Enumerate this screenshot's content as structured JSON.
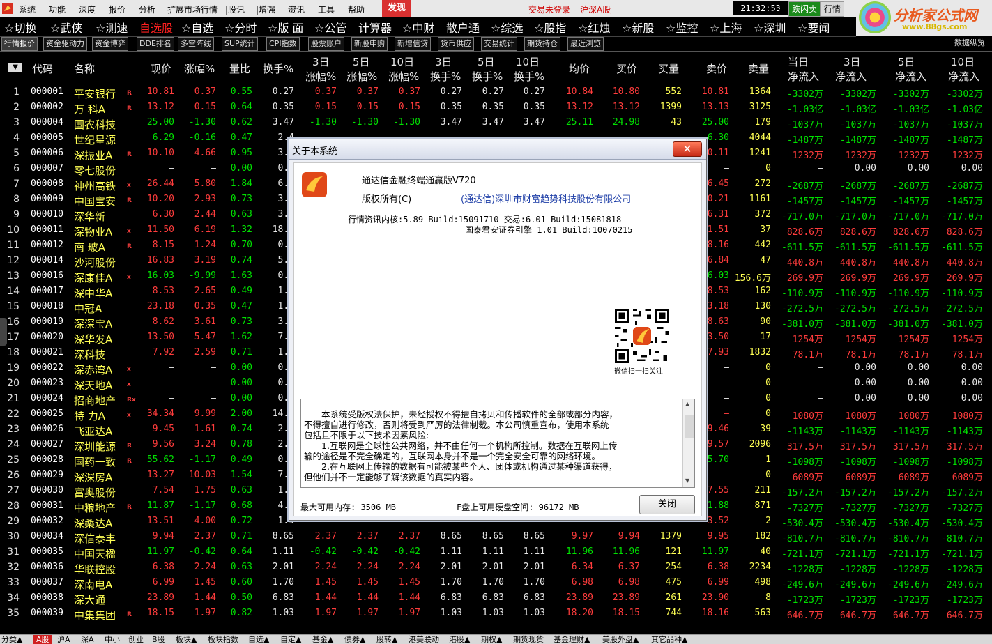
{
  "menu": {
    "items": [
      "系统",
      "功能",
      "深度",
      "报价",
      "分析",
      "扩展市场行情",
      "|股讯",
      "|增强",
      "资讯",
      "工具",
      "帮助"
    ],
    "find": "发现",
    "warn1": "交易未登录",
    "warn2": "沪深A股",
    "clock": "21:32:53",
    "weekday": "周日",
    "right_tabs": [
      "跌闪卖",
      "行情"
    ]
  },
  "brand": {
    "name": "分析家公式网",
    "url": "www.88gs.com"
  },
  "toolbar": [
    "☆切换",
    "☆武侠",
    "☆测速",
    "自选股",
    "☆自选",
    "☆分时",
    "☆版 面",
    "☆公管",
    "计算器",
    "☆中财",
    "散户通",
    "☆综选",
    "☆股指",
    "☆红烛",
    "☆新股",
    "☆监控",
    "☆上海",
    "☆深圳",
    "☆要闻"
  ],
  "subtabs": [
    "行情报价",
    "资金驱动力",
    "资金博弈",
    "DDE排名",
    "多空阵线",
    "SUP统计",
    "CPI指数",
    "股票账户",
    "新股申购",
    "新增信贷",
    "货币供应",
    "交易统计",
    "期货持仓",
    "最近浏览"
  ],
  "subtab_right": "数据纵览",
  "headers": {
    "code": "代码",
    "name": "名称",
    "price": "现价",
    "chg": "涨幅%",
    "vr": "量比",
    "turn": "换手%",
    "d3": "3日",
    "d5": "5日",
    "d10": "10日",
    "chgpct": "涨幅%",
    "turnpct": "换手%",
    "avg": "均价",
    "bid": "买价",
    "bidvol": "买量",
    "ask": "卖价",
    "askvol": "卖量",
    "today": "当日",
    "netflow": "净流入"
  },
  "rows": [
    [
      "1",
      "000001",
      "平安银行",
      "R",
      "10.81",
      "0.37",
      "0.55",
      "0.27",
      "0.37",
      "0.37",
      "0.37",
      "0.27",
      "0.27",
      "0.27",
      "10.84",
      "10.80",
      "552",
      "10.81",
      "1364",
      "-3302万",
      "-3302万",
      "-3302万",
      "-3302万"
    ],
    [
      "2",
      "000002",
      "万 科A",
      "R",
      "13.12",
      "0.15",
      "0.64",
      "0.35",
      "0.15",
      "0.15",
      "0.15",
      "0.35",
      "0.35",
      "0.35",
      "13.12",
      "13.12",
      "1399",
      "13.13",
      "3125",
      "-1.03亿",
      "-1.03亿",
      "-1.03亿",
      "-1.03亿"
    ],
    [
      "3",
      "000004",
      "国农科技",
      "",
      "25.00",
      "-1.30",
      "0.62",
      "3.47",
      "-1.30",
      "-1.30",
      "-1.30",
      "3.47",
      "3.47",
      "3.47",
      "25.11",
      "24.98",
      "43",
      "25.00",
      "179",
      "-1037万",
      "-1037万",
      "-1037万",
      "-1037万"
    ],
    [
      "4",
      "000005",
      "世纪星源",
      "",
      "6.29",
      "-0.16",
      "0.47",
      "2.4",
      "",
      "",
      "",
      "",
      "",
      "",
      "",
      "",
      "",
      "6.30",
      "4044",
      "-1487万",
      "-1487万",
      "-1487万",
      "-1487万"
    ],
    [
      "5",
      "000006",
      "深振业A",
      "R",
      "10.10",
      "4.66",
      "0.95",
      "3.6",
      "",
      "",
      "",
      "",
      "",
      "",
      "",
      "",
      "",
      "0.11",
      "1241",
      "1232万",
      "1232万",
      "1232万",
      "1232万"
    ],
    [
      "6",
      "000007",
      "零七股份",
      "",
      "—",
      "—",
      "0.00",
      "0.0",
      "",
      "",
      "",
      "",
      "",
      "",
      "",
      "",
      "",
      "—",
      "0",
      "—",
      "0.00",
      "0.00",
      "0.00"
    ],
    [
      "7",
      "000008",
      "神州高铁",
      "x",
      "26.44",
      "5.80",
      "1.84",
      "6.8",
      "",
      "",
      "",
      "",
      "",
      "",
      "",
      "",
      "",
      "6.45",
      "272",
      "-2687万",
      "-2687万",
      "-2687万",
      "-2687万"
    ],
    [
      "8",
      "000009",
      "中国宝安",
      "R",
      "10.20",
      "2.93",
      "0.73",
      "3.4",
      "",
      "",
      "",
      "",
      "",
      "",
      "",
      "",
      "",
      "0.21",
      "1161",
      "-1457万",
      "-1457万",
      "-1457万",
      "-1457万"
    ],
    [
      "9",
      "000010",
      "深华新",
      "",
      "6.30",
      "2.44",
      "0.63",
      "3.2",
      "",
      "",
      "",
      "",
      "",
      "",
      "",
      "",
      "",
      "6.31",
      "372",
      "-717.0万",
      "-717.0万",
      "-717.0万",
      "-717.0万"
    ],
    [
      "10",
      "000011",
      "深物业A",
      "x",
      "11.50",
      "6.19",
      "1.32",
      "18.0",
      "",
      "",
      "",
      "",
      "",
      "",
      "",
      "",
      "",
      "1.51",
      "37",
      "828.6万",
      "828.6万",
      "828.6万",
      "828.6万"
    ],
    [
      "11",
      "000012",
      "南 玻A",
      "R",
      "8.15",
      "1.24",
      "0.70",
      "0.9",
      "",
      "",
      "",
      "",
      "",
      "",
      "",
      "",
      "",
      "8.16",
      "442",
      "-611.5万",
      "-611.5万",
      "-611.5万",
      "-611.5万"
    ],
    [
      "12",
      "000014",
      "沙河股份",
      "",
      "16.83",
      "3.19",
      "0.74",
      "5.0",
      "",
      "",
      "",
      "",
      "",
      "",
      "",
      "",
      "",
      "6.84",
      "47",
      "440.8万",
      "440.8万",
      "440.8万",
      "440.8万"
    ],
    [
      "13",
      "000016",
      "深康佳A",
      "x",
      "16.03",
      "-9.99",
      "1.63",
      "0.0",
      "",
      "",
      "",
      "",
      "",
      "",
      "",
      "",
      "",
      "6.03",
      "156.6万",
      "269.9万",
      "269.9万",
      "269.9万",
      "269.9万"
    ],
    [
      "14",
      "000017",
      "深中华A",
      "",
      "8.53",
      "2.65",
      "0.49",
      "1.8",
      "",
      "",
      "",
      "",
      "",
      "",
      "",
      "",
      "",
      "8.53",
      "162",
      "-110.9万",
      "-110.9万",
      "-110.9万",
      "-110.9万"
    ],
    [
      "15",
      "000018",
      "中冠A",
      "",
      "23.18",
      "0.35",
      "0.47",
      "1.5",
      "",
      "",
      "",
      "",
      "",
      "",
      "",
      "",
      "",
      "3.18",
      "130",
      "-272.5万",
      "-272.5万",
      "-272.5万",
      "-272.5万"
    ],
    [
      "16",
      "000019",
      "深深宝A",
      "",
      "8.62",
      "3.61",
      "0.73",
      "3.5",
      "",
      "",
      "",
      "",
      "",
      "",
      "",
      "",
      "",
      "8.63",
      "90",
      "-381.0万",
      "-381.0万",
      "-381.0万",
      "-381.0万"
    ],
    [
      "17",
      "000020",
      "深华发A",
      "",
      "13.50",
      "5.47",
      "1.62",
      "7.6",
      "",
      "",
      "",
      "",
      "",
      "",
      "",
      "",
      "",
      "3.50",
      "17",
      "1254万",
      "1254万",
      "1254万",
      "1254万"
    ],
    [
      "18",
      "000021",
      "深科技",
      "",
      "7.92",
      "2.59",
      "0.71",
      "1.4",
      "",
      "",
      "",
      "",
      "",
      "",
      "",
      "",
      "",
      "7.93",
      "1832",
      "78.1万",
      "78.1万",
      "78.1万",
      "78.1万"
    ],
    [
      "19",
      "000022",
      "深赤湾A",
      "x",
      "—",
      "—",
      "0.00",
      "0.0",
      "",
      "",
      "",
      "",
      "",
      "",
      "",
      "",
      "",
      "—",
      "0",
      "—",
      "0.00",
      "0.00",
      "0.00"
    ],
    [
      "20",
      "000023",
      "深天地A",
      "x",
      "—",
      "—",
      "0.00",
      "0.0",
      "",
      "",
      "",
      "",
      "",
      "",
      "",
      "",
      "",
      "—",
      "0",
      "—",
      "0.00",
      "0.00",
      "0.00"
    ],
    [
      "21",
      "000024",
      "招商地产",
      "Rx",
      "—",
      "—",
      "0.00",
      "0.0",
      "",
      "",
      "",
      "",
      "",
      "",
      "",
      "",
      "",
      "—",
      "0",
      "—",
      "0.00",
      "0.00",
      "0.00"
    ],
    [
      "22",
      "000025",
      "特 力A",
      "x",
      "34.34",
      "9.99",
      "2.00",
      "14.2",
      "",
      "",
      "",
      "",
      "",
      "",
      "",
      "",
      "",
      "—",
      "0",
      "1080万",
      "1080万",
      "1080万",
      "1080万"
    ],
    [
      "23",
      "000026",
      "飞亚达A",
      "",
      "9.45",
      "1.61",
      "0.74",
      "2.4",
      "",
      "",
      "",
      "",
      "",
      "",
      "",
      "",
      "",
      "9.46",
      "39",
      "-1143万",
      "-1143万",
      "-1143万",
      "-1143万"
    ],
    [
      "24",
      "000027",
      "深圳能源",
      "R",
      "9.56",
      "3.24",
      "0.78",
      "2.7",
      "",
      "",
      "",
      "",
      "",
      "",
      "",
      "",
      "",
      "9.57",
      "2096",
      "317.5万",
      "317.5万",
      "317.5万",
      "317.5万"
    ],
    [
      "25",
      "000028",
      "国药一致",
      "R",
      "55.62",
      "-1.17",
      "0.49",
      "0.6",
      "",
      "",
      "",
      "",
      "",
      "",
      "",
      "",
      "",
      "5.70",
      "1",
      "-1098万",
      "-1098万",
      "-1098万",
      "-1098万"
    ],
    [
      "26",
      "000029",
      "深深房A",
      "",
      "13.27",
      "10.03",
      "1.54",
      "7.9",
      "",
      "",
      "",
      "",
      "",
      "",
      "",
      "",
      "",
      "—",
      "0",
      "6089万",
      "6089万",
      "6089万",
      "6089万"
    ],
    [
      "27",
      "000030",
      "富奥股份",
      "",
      "7.54",
      "1.75",
      "0.63",
      "1.3",
      "",
      "",
      "",
      "",
      "",
      "",
      "",
      "",
      "",
      "7.55",
      "211",
      "-157.2万",
      "-157.2万",
      "-157.2万",
      "-157.2万"
    ],
    [
      "28",
      "000031",
      "中粮地产",
      "R",
      "11.87",
      "-1.17",
      "0.68",
      "4.5",
      "",
      "",
      "",
      "",
      "",
      "",
      "",
      "",
      "",
      "1.88",
      "871",
      "-7327万",
      "-7327万",
      "-7327万",
      "-7327万"
    ],
    [
      "29",
      "000032",
      "深桑达A",
      "",
      "13.51",
      "4.00",
      "0.72",
      "1.9",
      "",
      "",
      "",
      "",
      "",
      "",
      "",
      "",
      "",
      "3.52",
      "2",
      "-530.4万",
      "-530.4万",
      "-530.4万",
      "-530.4万"
    ],
    [
      "30",
      "000034",
      "深信泰丰",
      "",
      "9.94",
      "2.37",
      "0.71",
      "8.65",
      "2.37",
      "2.37",
      "2.37",
      "8.65",
      "8.65",
      "8.65",
      "9.97",
      "9.94",
      "1379",
      "9.95",
      "182",
      "-810.7万",
      "-810.7万",
      "-810.7万",
      "-810.7万"
    ],
    [
      "31",
      "000035",
      "中国天楹",
      "",
      "11.97",
      "-0.42",
      "0.64",
      "1.11",
      "-0.42",
      "-0.42",
      "-0.42",
      "1.11",
      "1.11",
      "1.11",
      "11.96",
      "11.96",
      "121",
      "11.97",
      "40",
      "-721.1万",
      "-721.1万",
      "-721.1万",
      "-721.1万"
    ],
    [
      "32",
      "000036",
      "华联控股",
      "",
      "6.38",
      "2.24",
      "0.63",
      "2.01",
      "2.24",
      "2.24",
      "2.24",
      "2.01",
      "2.01",
      "2.01",
      "6.34",
      "6.37",
      "254",
      "6.38",
      "2234",
      "-1228万",
      "-1228万",
      "-1228万",
      "-1228万"
    ],
    [
      "33",
      "000037",
      "深南电A",
      "",
      "6.99",
      "1.45",
      "0.60",
      "1.70",
      "1.45",
      "1.45",
      "1.45",
      "1.70",
      "1.70",
      "1.70",
      "6.98",
      "6.98",
      "475",
      "6.99",
      "498",
      "-249.6万",
      "-249.6万",
      "-249.6万",
      "-249.6万"
    ],
    [
      "34",
      "000038",
      "深大通",
      "",
      "23.89",
      "1.44",
      "0.50",
      "6.83",
      "1.44",
      "1.44",
      "1.44",
      "6.83",
      "6.83",
      "6.83",
      "23.89",
      "23.89",
      "261",
      "23.90",
      "8",
      "-1723万",
      "-1723万",
      "-1723万",
      "-1723万"
    ],
    [
      "35",
      "000039",
      "中集集团",
      "R",
      "18.15",
      "1.97",
      "0.82",
      "1.03",
      "1.97",
      "1.97",
      "1.97",
      "1.03",
      "1.03",
      "1.03",
      "18.20",
      "18.15",
      "744",
      "18.16",
      "563",
      "646.7万",
      "646.7万",
      "646.7万",
      "646.7万"
    ]
  ],
  "bottom_tabs": [
    "分类▲",
    "A股",
    "沪A",
    "深A",
    "中小",
    "创业",
    "B股",
    "板块▲",
    "板块指数",
    "自选▲",
    "自定▲",
    "基金▲",
    "债券▲",
    "股转▲",
    "港美联动",
    "港股▲",
    "期权▲",
    "期货现货",
    "基金理财▲",
    "美股外盘▲",
    "其它品种▲"
  ],
  "dialog": {
    "title": "关于本系统",
    "close_x": "✕",
    "product": "通达信金融终端通赢版V720",
    "copyright_label": "版权所有(C)",
    "company": "(通达信)深圳市财富趋势科技股份有限公司",
    "build1": "行情资讯内核:5.89 Build:15091710 交易:6.01 Build:15081818",
    "build2": "国泰君安证券引擎 1.01 Build:10070215",
    "qr_caption": "微信扫一扫关注",
    "disclaimer": [
      "　　本系统受版权法保护，未经授权不得擅自拷贝和传播软件的全部或部分内容，",
      "不得擅自进行修改，否则将受到严厉的法律制裁。本公司慎重宣布，使用本系统",
      "包括且不限于以下技术因素风险:",
      "　　1.互联网是全球性公共网络，并不由任何一个机构所控制。数据在互联网上传",
      "输的途径是不完全确定的，互联网本身并不是一个完全安全可靠的网络环境。",
      "　　2.在互联网上传输的数据有可能被某些个人、团体或机构通过某种渠道获得，",
      "但他们并不一定能够了解该数据的真实内容。"
    ],
    "mem": "最大可用内存: 3506 MB",
    "disk": "F盘上可用硬盘空间: 96172 MB",
    "close_btn": "关闭"
  }
}
